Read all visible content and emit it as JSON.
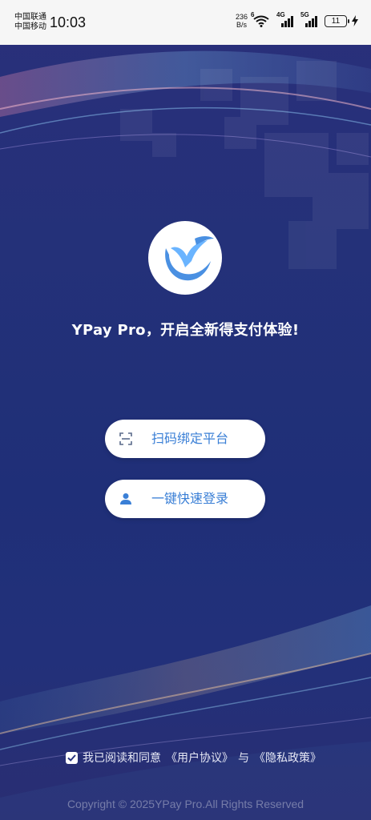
{
  "status_bar": {
    "carrier_1": "中国联通",
    "carrier_2": "中国移动",
    "time": "10:03",
    "net_speed_value": "236",
    "net_speed_unit": "B/s",
    "wifi_badge": "6",
    "cell_1_label": "4G",
    "cell_2_label": "5G",
    "battery_level": "11"
  },
  "app": {
    "slogan": "YPay Pro，开启全新得支付体验!",
    "scan_button_label": "扫码绑定平台",
    "login_button_label": "一键快速登录",
    "agreement_prefix": "我已阅读和同意",
    "user_agreement_link": "《用户协议》",
    "agreement_conjunction": "与",
    "privacy_policy_link": "《隐私政策》",
    "copyright": "Copyright © 2025YPay Pro.All Rights Reserved"
  },
  "theme": {
    "background": "#243179",
    "accent": "#3a7fd6",
    "logo_blue": "#4a90e2"
  },
  "icons": {
    "scan": "scan-icon",
    "user": "user-icon",
    "checkbox": "checkmark-icon"
  }
}
